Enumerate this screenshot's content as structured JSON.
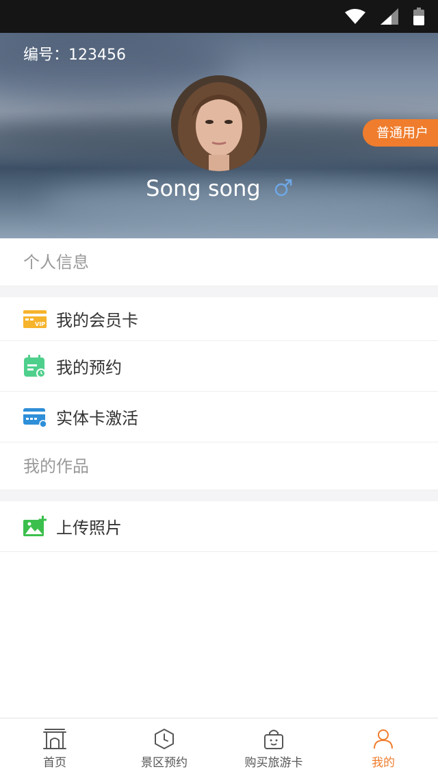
{
  "status_bar": {
    "icons": [
      "wifi-icon",
      "signal-icon",
      "battery-icon"
    ]
  },
  "profile": {
    "member_id_label": "编号：",
    "member_id": "123456",
    "name": "Song song",
    "gender_symbol": "♂",
    "user_tag": "普通用户"
  },
  "sections": {
    "personal_info": "个人信息",
    "my_works": "我的作品"
  },
  "menu": {
    "membership_card": "我的会员卡",
    "reservations": "我的预约",
    "card_activation": "实体卡激活",
    "upload_photo": "上传照片"
  },
  "tabbar": {
    "home": "首页",
    "scenic_booking": "景区预约",
    "buy_travel_card": "购买旅游卡",
    "mine": "我的"
  },
  "colors": {
    "accent": "#ef7d2d",
    "vip_icon": "#f6b32c",
    "reservation_icon": "#4fcf8c",
    "card_icon": "#2f8fd8",
    "upload_icon": "#3bbf4c",
    "gender_icon": "#6fa8e6"
  }
}
